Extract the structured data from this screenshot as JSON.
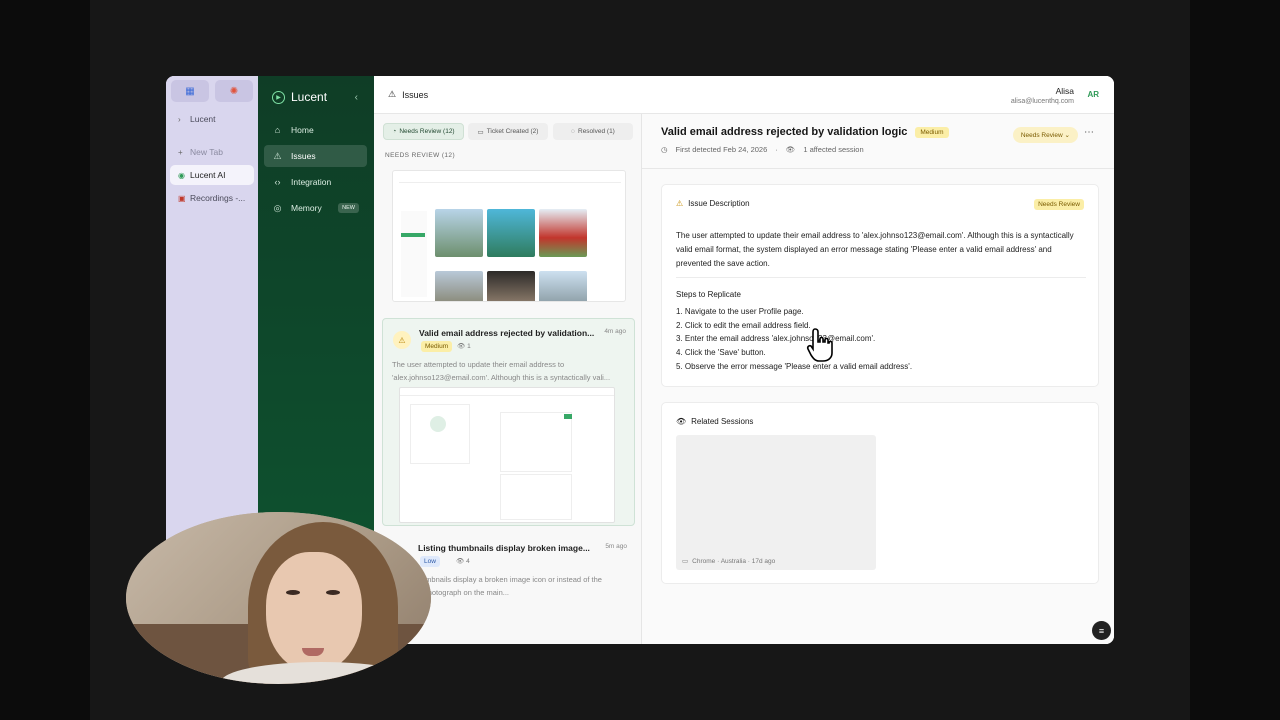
{
  "browser": {
    "tabs": [
      {
        "label": "Lucent",
        "icon": "chevron-right-icon"
      },
      {
        "label": "New Tab",
        "icon": "plus-icon"
      },
      {
        "label": "Lucent AI",
        "icon": "app-icon"
      },
      {
        "label": "Recordings -...",
        "icon": "recordings-icon"
      }
    ]
  },
  "app": {
    "brand": "Lucent",
    "nav": [
      {
        "label": "Home",
        "icon": "home-icon"
      },
      {
        "label": "Issues",
        "icon": "warning-icon"
      },
      {
        "label": "Integration",
        "icon": "code-icon"
      },
      {
        "label": "Memory",
        "icon": "memory-icon",
        "badge": "NEW"
      }
    ]
  },
  "topbar": {
    "title": "Issues",
    "user_name": "Alisa",
    "user_email": "alisa@lucenthq.com",
    "avatar": "AR"
  },
  "list": {
    "filters": [
      {
        "label": "Needs Review (12)",
        "active": true
      },
      {
        "label": "Ticket Created (2)",
        "active": false
      },
      {
        "label": "Resolved (1)",
        "active": false
      }
    ],
    "section_label": "NEEDS REVIEW (12)",
    "issues": [
      {
        "title": "Valid email address rejected by validation...",
        "time": "4m ago",
        "severity": "Medium",
        "views": "1",
        "description": "The user attempted to update their email address to 'alex.johnso123@email.com'. Although this is a syntactically vali..."
      },
      {
        "title": "Listing thumbnails display broken image...",
        "time": "5m ago",
        "severity": "Low",
        "views": "4",
        "description": "Listing thumbnails display a broken image icon or instead of the expected photograph on the main..."
      }
    ]
  },
  "detail": {
    "title": "Valid email address rejected by validation logic",
    "severity": "Medium",
    "first_detected": "First detected Feb 24, 2026",
    "sessions_count": "1 affected session",
    "status": "Needs Review",
    "description_heading": "Issue Description",
    "description_tag": "Needs Review",
    "description": "The user attempted to update their email address to 'alex.johnso123@email.com'. Although this is a syntactically valid email format, the system displayed an error message stating 'Please enter a valid email address' and prevented the save action.",
    "steps_heading": "Steps to Replicate",
    "steps": [
      "1. Navigate to the user Profile page.",
      "2. Click to edit the email address field.",
      "3. Enter the email address 'alex.johnso123@email.com'.",
      "4. Click the 'Save' button.",
      "5. Observe the error message 'Please enter a valid email address'."
    ],
    "related_heading": "Related Sessions",
    "session_meta": "Chrome · Australia · 17d ago"
  },
  "colors": {
    "nav_green": "#0f4a2c",
    "medium_badge": "#fbeea7",
    "low_badge": "#dfe9fb",
    "accent_green": "#2f9a57"
  }
}
